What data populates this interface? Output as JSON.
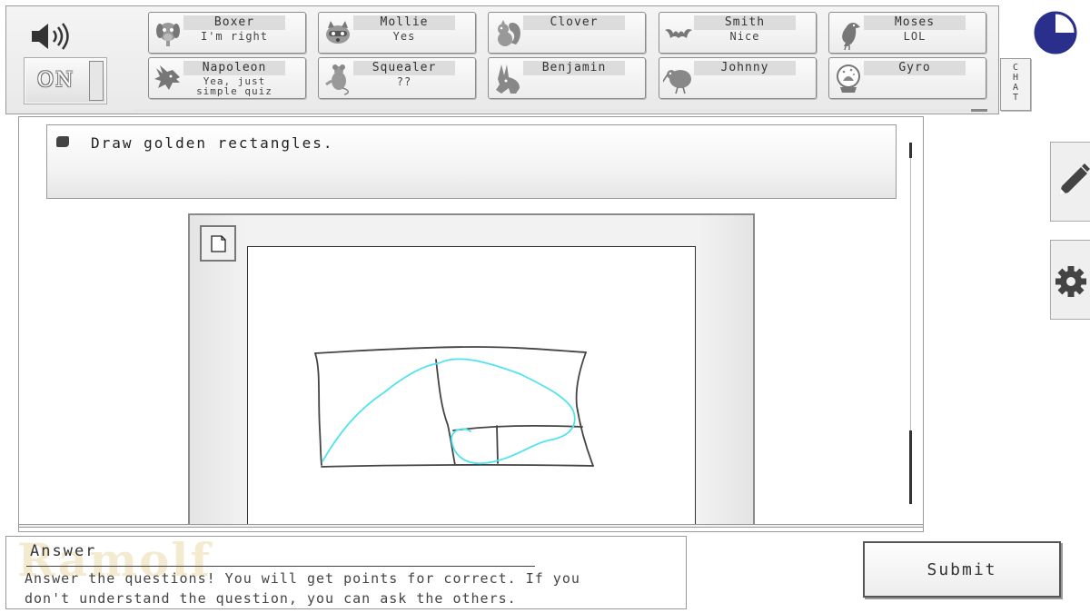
{
  "audio": {
    "icon": "speaker-icon"
  },
  "power": {
    "label": "ON"
  },
  "players": [
    {
      "name": "Boxer",
      "status": "I'm right",
      "icon": "dog-icon"
    },
    {
      "name": "Mollie",
      "status": "Yes",
      "icon": "raccoon-icon"
    },
    {
      "name": "Clover",
      "status": "",
      "icon": "squirrel-icon"
    },
    {
      "name": "Smith",
      "status": "Nice",
      "icon": "bat-icon"
    },
    {
      "name": "Moses",
      "status": "LOL",
      "icon": "crow-icon"
    },
    {
      "name": "Napoleon",
      "status": "Yea, just simple quiz",
      "icon": "wolf-icon"
    },
    {
      "name": "Squealer",
      "status": "??",
      "icon": "rat-icon"
    },
    {
      "name": "Benjamin",
      "status": "",
      "icon": "donkey-icon"
    },
    {
      "name": "Johnny",
      "status": "",
      "icon": "kiwi-bird-icon"
    },
    {
      "name": "Gyro",
      "status": "",
      "icon": "snow-globe-icon"
    }
  ],
  "chat": {
    "label": "CHAT"
  },
  "timer": {
    "remaining_fraction": 0.75
  },
  "question": {
    "text": "Draw golden rectangles."
  },
  "answer": {
    "label": "Answer",
    "watermark": "Ramolf",
    "value": "",
    "instructions_line1": "Answer the questions! You will get points for correct. If you",
    "instructions_line2": "don't understand the question, you can ask the others."
  },
  "submit": {
    "label": "Submit"
  },
  "colors": {
    "ink": "#444444",
    "cyan_stroke": "#4fe3f0",
    "timer_fill": "#2b2f8c"
  }
}
